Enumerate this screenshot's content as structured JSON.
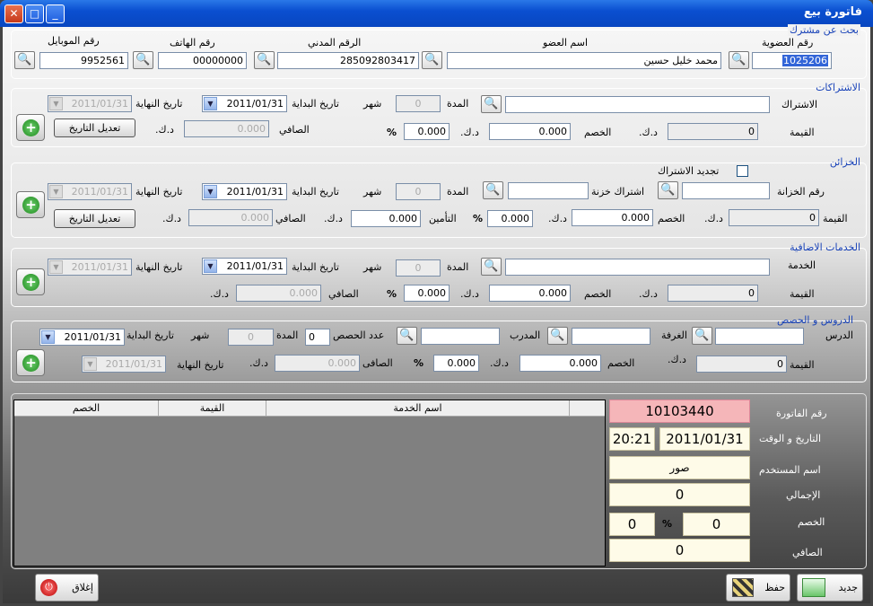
{
  "window": {
    "title": "فاتورة بيع",
    "close_glyph": "✕",
    "max_glyph": "□",
    "min_glyph": "_"
  },
  "search_member": {
    "title": "بحث عن مشترك",
    "member_no_label": "رقم العضوية",
    "member_no": "1025206",
    "member_name_label": "اسم العضو",
    "member_name": "محمد خليل   حسين",
    "civil_id_label": "الرقم المدني",
    "civil_id": "285092803417",
    "phone_label": "رقم الهاتف",
    "phone": "00000000",
    "mobile_label": "رقم الموبايل",
    "mobile": "9952561"
  },
  "subscriptions": {
    "title": "الاشتراكات",
    "subscription_label": "الاشتراك",
    "subscription": "",
    "duration_label": "المدة",
    "duration": "0",
    "month_label": "شهر",
    "start_label": "تاريخ البداية",
    "start_date": "2011/01/31",
    "end_label": "تاريخ النهاية",
    "end_date": "2011/01/31",
    "value_label": "القيمة",
    "value": "0",
    "kd": "د.ك.",
    "discount_label": "الخصم",
    "discount": "0.000",
    "discount_pct": "0.000",
    "pct": "%",
    "net_label": "الصافي",
    "net": "0.000",
    "edit_date_button": "تعديل التاريخ"
  },
  "lockers": {
    "title": "الخزائن",
    "renew_label": "تجديد الاشتراك",
    "locker_no_label": "رقم الخزانة",
    "locker_no": "",
    "locker_sub_label": "اشتراك خزنة",
    "locker_sub": "",
    "duration_label": "المدة",
    "duration": "0",
    "month_label": "شهر",
    "start_label": "تاريخ البداية",
    "start_date": "2011/01/31",
    "end_label": "تاريخ النهاية",
    "end_date": "2011/01/31",
    "value_label": "القيمة",
    "value": "0",
    "kd": "د.ك.",
    "discount_label": "الخصم",
    "discount": "0.000",
    "discount_pct": "0.000",
    "pct": "%",
    "insurance_label": "التأمين",
    "insurance": "0.000",
    "net_label": "الصافي",
    "net": "0.000",
    "edit_date_button": "تعديل التاريخ"
  },
  "extra_services": {
    "title": "الخدمات الاضافية",
    "service_label": "الخدمة",
    "service": "",
    "duration_label": "المدة",
    "duration": "0",
    "month_label": "شهر",
    "start_label": "تاريخ البداية",
    "start_date": "2011/01/31",
    "end_label": "تاريخ النهاية",
    "end_date": "2011/01/31",
    "value_label": "القيمة",
    "value": "0",
    "kd": "د.ك.",
    "discount_label": "الخصم",
    "discount": "0.000",
    "discount_pct": "0.000",
    "pct": "%",
    "net_label": "الصافي",
    "net": "0.000"
  },
  "lessons": {
    "title": "الدروس و الحصص",
    "lesson_label": "الدرس",
    "lesson": "",
    "room_label": "الغرفة",
    "room": "",
    "trainer_label": "المدرب",
    "trainer": "",
    "sessions_label": "عدد الحصص",
    "sessions": "0",
    "duration_label": "المدة",
    "duration": "0",
    "month_label": "شهر",
    "start_label": "تاريخ البداية",
    "start_date": "2011/01/31",
    "end_label": "تاريخ النهاية",
    "end_date": "2011/01/31",
    "value_label": "القيمة",
    "value": "0",
    "kd": "د.ك.",
    "discount_label": "الخصم",
    "discount": "0.000",
    "discount_pct": "0.000",
    "pct": "%",
    "net_label": "الصافى",
    "net": "0.000"
  },
  "grid": {
    "columns": [
      "اسم الخدمة",
      "القيمة",
      "الخصم"
    ]
  },
  "invoice": {
    "invoice_no_label": "رقم الفاتورة",
    "invoice_no": "10103440",
    "datetime_label": "التاريخ و الوقت",
    "date": "2011/01/31",
    "time": "20:21",
    "user_label": "اسم المستخدم",
    "user": "صور",
    "total_label": "الإجمالي",
    "total": "0",
    "discount_label": "الخصم",
    "discount": "0",
    "discount_pct": "0",
    "pct": "%",
    "net_label": "الصافي",
    "net": "0"
  },
  "buttons": {
    "new": "جديد",
    "save": "حفظ",
    "close": "إغلاق"
  },
  "icons": {
    "search": "search-icon",
    "add": "add-icon",
    "power": "power-icon",
    "save": "save-icon",
    "new": "new-icon",
    "dropdown": "chevron-down-icon"
  },
  "colors": {
    "title_bar": "#0a4fd0",
    "section_title": "#1842b8",
    "invoice_no_bg": "#f5b6b9",
    "summary_bg": "#fefbe8"
  }
}
